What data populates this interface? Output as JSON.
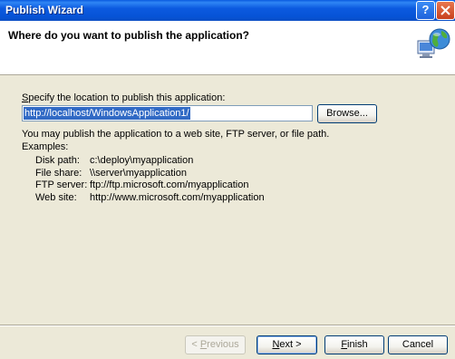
{
  "window": {
    "title": "Publish Wizard",
    "help_button": "?",
    "close_button": "X"
  },
  "header": {
    "heading": "Where do you want to publish the application?"
  },
  "location": {
    "label_accel": "S",
    "label_rest": "pecify the location to publish this application:",
    "url_value": "http://localhost/WindowsApplication1/",
    "browse_label": "Browse..."
  },
  "info_text": "You may publish the application to a web site, FTP server, or file path.",
  "examples": {
    "heading": "Examples:",
    "rows": [
      {
        "label": "Disk path:",
        "value": "c:\\deploy\\myapplication"
      },
      {
        "label": "File share:",
        "value": "\\\\server\\myapplication"
      },
      {
        "label": "FTP server:",
        "value": "ftp://ftp.microsoft.com/myapplication"
      },
      {
        "label": "Web site:",
        "value": "http://www.microsoft.com/myapplication"
      }
    ]
  },
  "buttons": {
    "previous_accel": "P",
    "previous_rest": "revious",
    "previous_prefix": "< ",
    "next_accel": "N",
    "next_rest": "ext >",
    "finish_accel": "F",
    "finish_rest": "inish",
    "cancel_label": "Cancel"
  }
}
